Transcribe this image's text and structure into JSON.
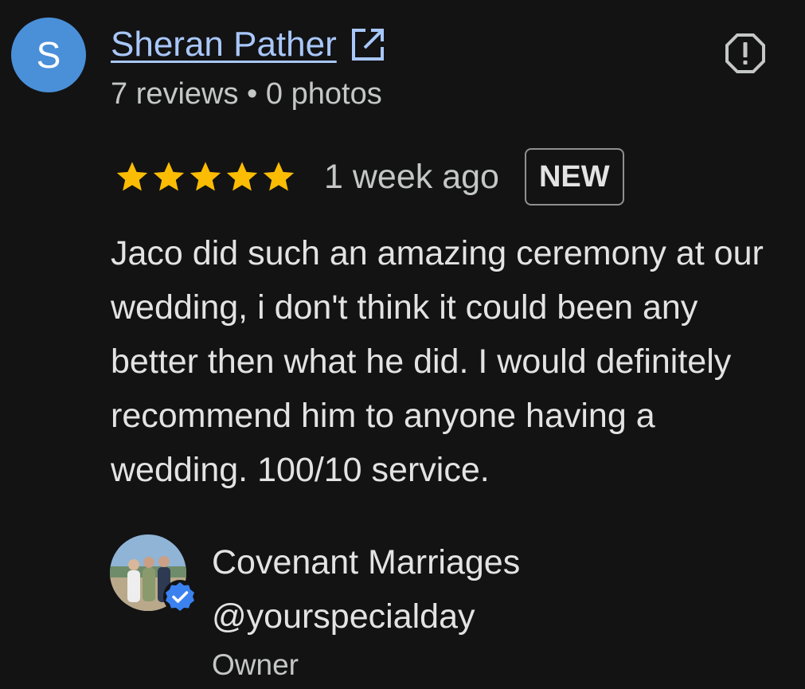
{
  "reviewer": {
    "initial": "S",
    "name": "Sheran Pather",
    "meta": "7 reviews • 0 photos",
    "avatar_color": "#4a90d9",
    "link_icon": "open-in-new-icon"
  },
  "report": {
    "icon": "report-flag-icon"
  },
  "rating": {
    "stars": 5,
    "max": 5,
    "star_color": "#fbbc04",
    "time": "1 week ago",
    "badge": "NEW"
  },
  "review": {
    "text": "Jaco did such an amazing ceremony at our wedding, i don't think it could been any better then what he did. I would definitely recommend him to anyone having a wedding. 100/10 service."
  },
  "owner_reply": {
    "name": "Covenant Marriages",
    "handle": "@yourspecialday",
    "role": "Owner",
    "verified_icon": "verified-badge-icon"
  },
  "colors": {
    "background": "#131314",
    "link": "#a8c7fa",
    "text": "#e3e3e3",
    "secondary_text": "#c4c7c5"
  }
}
